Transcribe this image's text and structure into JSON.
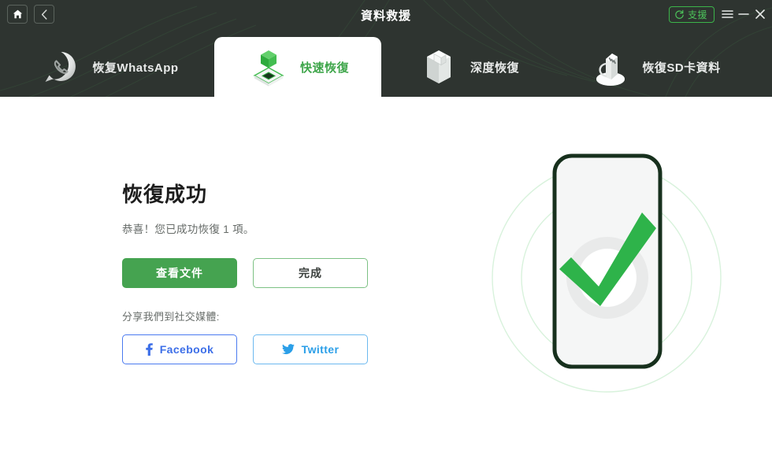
{
  "window": {
    "title": "資料救援",
    "home_icon": "home-icon",
    "back_icon": "chevron-left-icon",
    "support_label": "支援",
    "support_icon": "refresh-support-icon",
    "menu_icon": "hamburger-menu-icon",
    "minimize_icon": "minimize-icon",
    "close_icon": "close-icon",
    "header_bg": "#2e3430",
    "accent": "#45a350"
  },
  "tabs": [
    {
      "label": "恢复WhatsApp",
      "icon": "whatsapp-phone-icon",
      "active": false
    },
    {
      "label": "快速恢復",
      "icon": "green-cube-icon",
      "active": true
    },
    {
      "label": "深度恢復",
      "icon": "open-box-icon",
      "active": false
    },
    {
      "label": "恢復SD卡資料",
      "icon": "sd-card-reader-icon",
      "active": false
    }
  ],
  "main": {
    "headline": "恢復成功",
    "subtext": "恭喜！您已成功恢復 1 項。",
    "primary_button": "查看文件",
    "secondary_button": "完成",
    "share_label": "分享我們到社交媒體:",
    "social": [
      {
        "label": "Facebook",
        "icon": "facebook-icon",
        "color": "#3d6fe8"
      },
      {
        "label": "Twitter",
        "icon": "twitter-bird-icon",
        "color": "#2b9fe8"
      }
    ],
    "illustration": {
      "name": "phone-success-checkmark-illustration",
      "check_color": "#2eb34a",
      "phone_border": "#14301c"
    }
  }
}
